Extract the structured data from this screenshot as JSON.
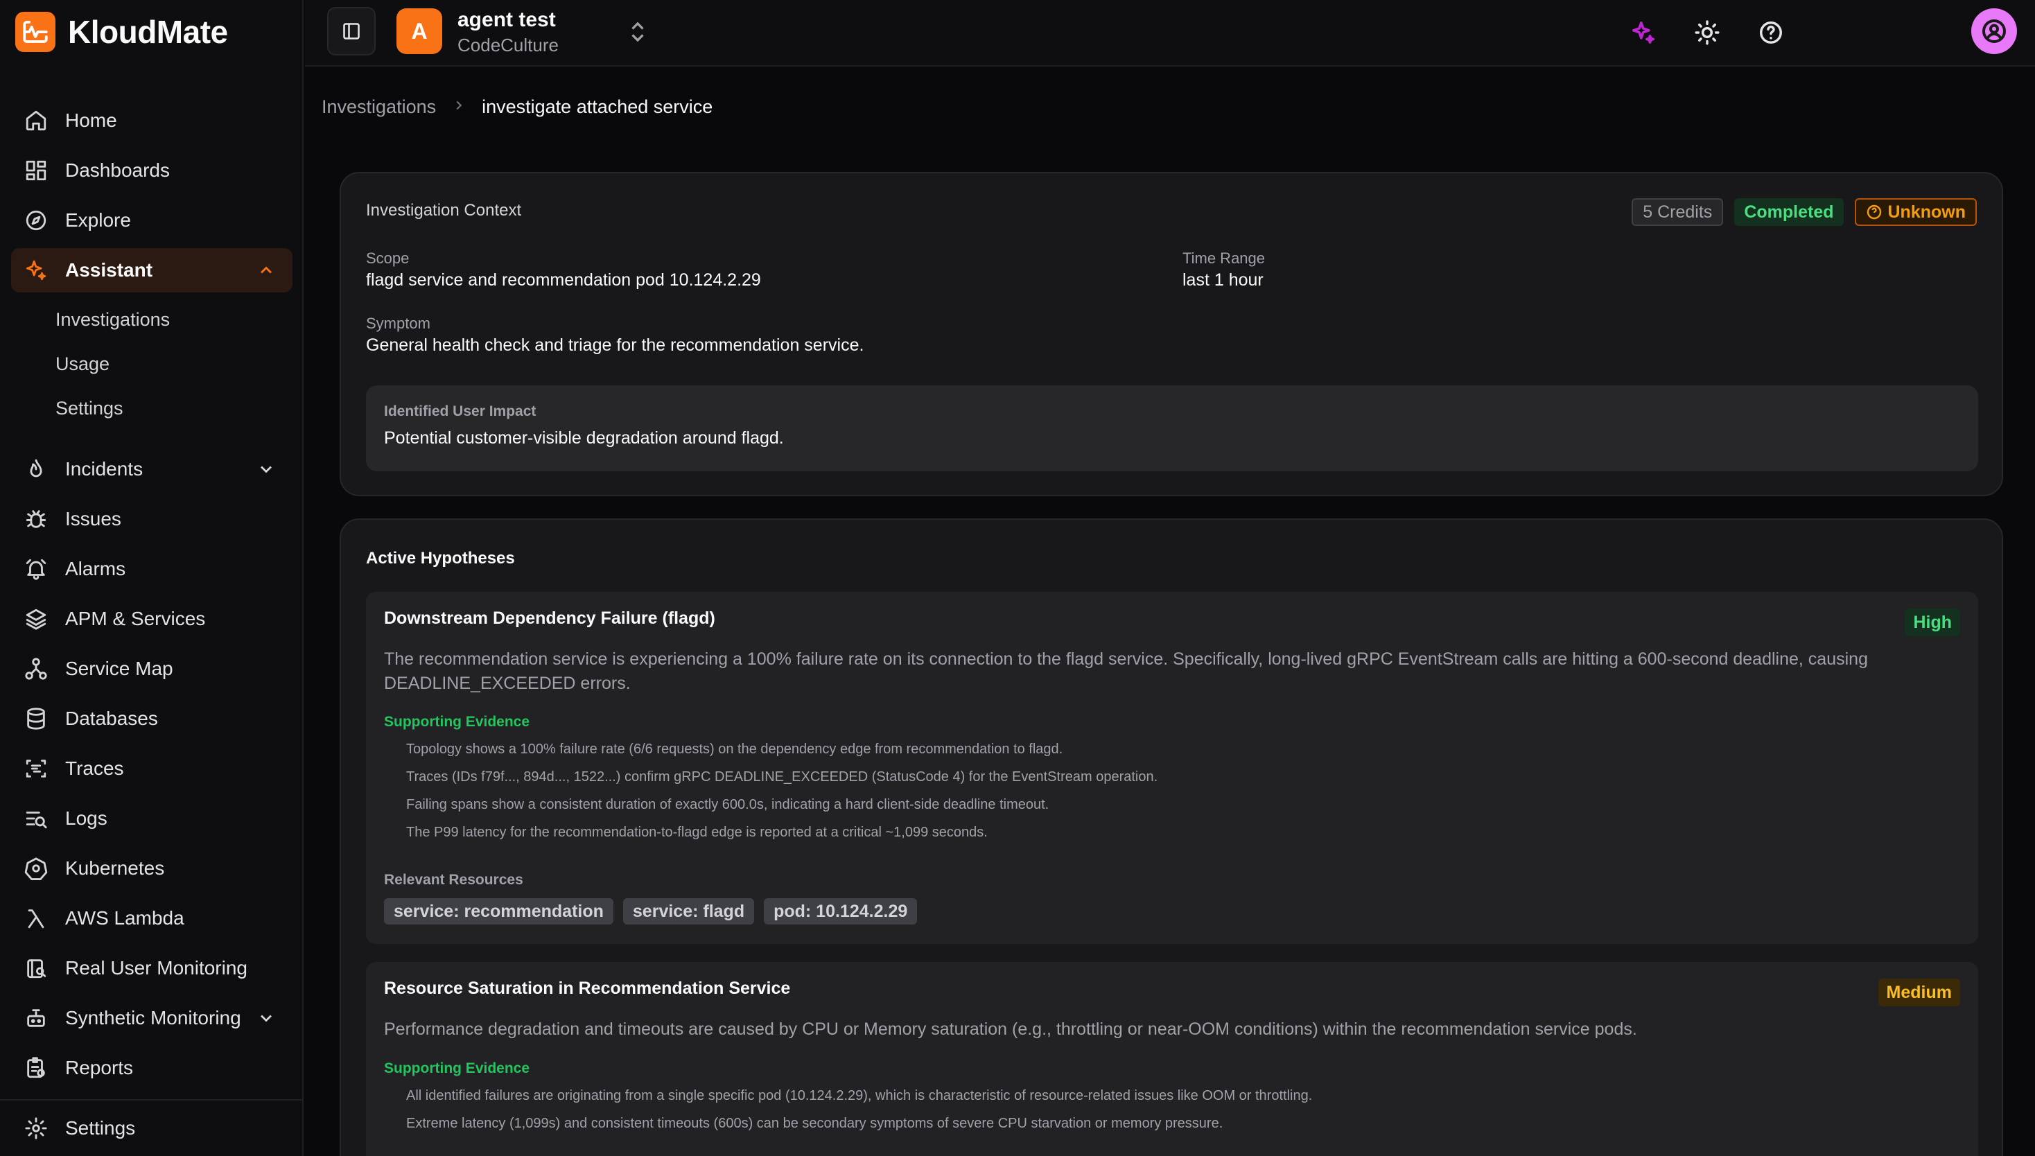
{
  "app": {
    "name": "KloudMate",
    "brand_color": "#f97316"
  },
  "sidebar": {
    "items": [
      {
        "label": "Home",
        "icon": "home-icon"
      },
      {
        "label": "Dashboards",
        "icon": "dashboard-icon"
      },
      {
        "label": "Explore",
        "icon": "compass-icon"
      },
      {
        "label": "Assistant",
        "icon": "sparkles-icon",
        "active": true,
        "expanded": true
      },
      {
        "label": "Incidents",
        "icon": "flame-icon"
      },
      {
        "label": "Issues",
        "icon": "bug-icon"
      },
      {
        "label": "Alarms",
        "icon": "bell-icon"
      },
      {
        "label": "APM & Services",
        "icon": "layers-icon"
      },
      {
        "label": "Service Map",
        "icon": "network-icon"
      },
      {
        "label": "Databases",
        "icon": "database-icon"
      },
      {
        "label": "Traces",
        "icon": "traces-icon"
      },
      {
        "label": "Logs",
        "icon": "logs-icon"
      },
      {
        "label": "Kubernetes",
        "icon": "kubernetes-icon"
      },
      {
        "label": "AWS Lambda",
        "icon": "lambda-icon"
      },
      {
        "label": "Real User Monitoring",
        "icon": "rum-icon"
      },
      {
        "label": "Synthetic Monitoring",
        "icon": "robot-icon"
      },
      {
        "label": "Reports",
        "icon": "reports-icon"
      },
      {
        "label": "Settings",
        "icon": "gear-icon"
      }
    ],
    "assistant_sub": [
      "Investigations",
      "Usage",
      "Settings"
    ]
  },
  "topbar": {
    "org_initial": "A",
    "org_name": "agent test",
    "org_sub": "CodeCulture"
  },
  "breadcrumb": {
    "parent": "Investigations",
    "current": "investigate attached service"
  },
  "context": {
    "title": "Investigation Context",
    "credits": "5 Credits",
    "status": "Completed",
    "verdict": "Unknown",
    "scope_label": "Scope",
    "scope": "flagd service and recommendation pod 10.124.2.29",
    "time_range_label": "Time Range",
    "time_range": "last 1 hour",
    "symptom_label": "Symptom",
    "symptom": "General health check and triage for the recommendation service.",
    "impact_label": "Identified User Impact",
    "impact": "Potential customer-visible degradation around flagd."
  },
  "hypotheses": {
    "title": "Active Hypotheses",
    "evidence_label": "Supporting Evidence",
    "resources_label": "Relevant Resources",
    "items": [
      {
        "name": "Downstream Dependency Failure (flagd)",
        "severity": "High",
        "description": "The recommendation service is experiencing a 100% failure rate on its connection to the flagd service. Specifically, long-lived gRPC EventStream calls are hitting a 600-second deadline, causing DEADLINE_EXCEEDED errors.",
        "evidence": [
          "Topology shows a 100% failure rate (6/6 requests) on the dependency edge from recommendation to flagd.",
          "Traces (IDs f79f..., 894d..., 1522...) confirm gRPC DEADLINE_EXCEEDED (StatusCode 4) for the EventStream operation.",
          "Failing spans show a consistent duration of exactly 600.0s, indicating a hard client-side deadline timeout.",
          "The P99 latency for the recommendation-to-flagd edge is reported at a critical ~1,099 seconds."
        ],
        "resources": [
          "service: recommendation",
          "service: flagd",
          "pod: 10.124.2.29"
        ]
      },
      {
        "name": "Resource Saturation in Recommendation Service",
        "severity": "Medium",
        "description": "Performance degradation and timeouts are caused by CPU or Memory saturation (e.g., throttling or near-OOM conditions) within the recommendation service pods.",
        "evidence": [
          "All identified failures are originating from a single specific pod (10.124.2.29), which is characteristic of resource-related issues like OOM or throttling.",
          "Extreme latency (1,099s) and consistent timeouts (600s) can be secondary symptoms of severe CPU starvation or memory pressure."
        ]
      }
    ]
  }
}
